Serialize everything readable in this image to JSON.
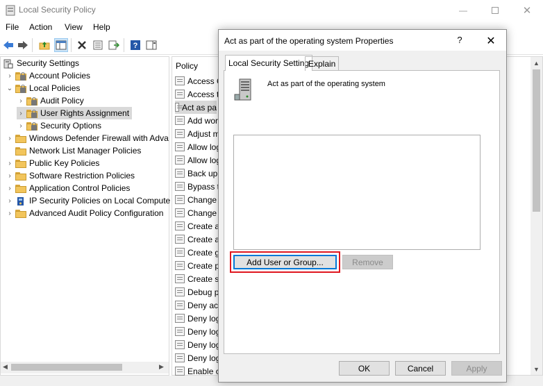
{
  "window": {
    "title": "Local Security Policy"
  },
  "menu": [
    "File",
    "Action",
    "View",
    "Help"
  ],
  "tree": {
    "items": [
      {
        "label": "Security Settings"
      },
      {
        "label": "Account Policies"
      },
      {
        "label": "Local Policies"
      },
      {
        "label": "Audit Policy"
      },
      {
        "label": "User Rights Assignment"
      },
      {
        "label": "Security Options"
      },
      {
        "label": "Windows Defender Firewall with Adva"
      },
      {
        "label": "Network List Manager Policies"
      },
      {
        "label": "Public Key Policies"
      },
      {
        "label": "Software Restriction Policies"
      },
      {
        "label": "Application Control Policies"
      },
      {
        "label": "IP Security Policies on Local Compute"
      },
      {
        "label": "Advanced Audit Policy Configuration"
      }
    ]
  },
  "policy_list": {
    "header": "Policy",
    "rows": [
      "Access C",
      "Access th",
      "Act as pa",
      "Add wor",
      "Adjust m",
      "Allow log",
      "Allow log",
      "Back up",
      "Bypass tr",
      "Change t",
      "Change t",
      "Create a",
      "Create a",
      "Create gl",
      "Create p",
      "Create sy",
      "Debug p",
      "Deny acc",
      "Deny log",
      "Deny log",
      "Deny log",
      "Deny log",
      "Enable c"
    ]
  },
  "dialog": {
    "title": "Act as part of the operating system Properties",
    "help": "?",
    "close": "✕",
    "tabs": [
      "Local Security Setting",
      "Explain"
    ],
    "policy_name": "Act as part of the operating system",
    "buttons": {
      "add": "Add User or Group...",
      "remove": "Remove",
      "ok": "OK",
      "cancel": "Cancel",
      "apply": "Apply"
    }
  }
}
